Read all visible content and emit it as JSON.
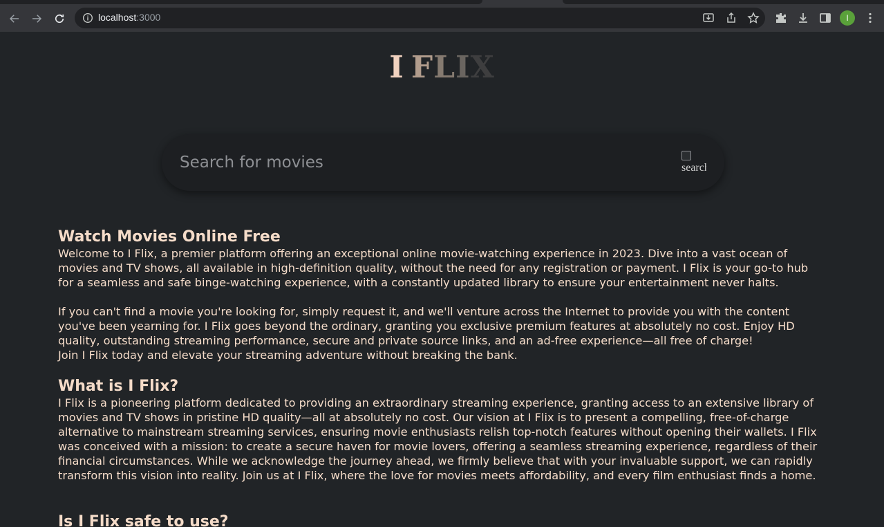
{
  "browser": {
    "url_host": "localhost",
    "url_port": ":3000",
    "profile_initial": "I"
  },
  "site": {
    "logo_letters": [
      "I",
      " ",
      "F",
      "L",
      "I",
      "X"
    ],
    "logo_colors": [
      "#f1d2bf",
      "#f1d2bf",
      "#b19c8c",
      "#857a70",
      "#6a6560",
      "#3e3e3f"
    ],
    "search_placeholder": "Search for movies",
    "search_icon_alt": "search"
  },
  "sections": [
    {
      "heading": "Watch Movies Online Free",
      "paragraphs": [
        "Welcome to I Flix, a premier platform offering an exceptional online movie-watching experience in 2023. Dive into a vast ocean of movies and TV shows, all available in high-definition quality, without the need for any registration or payment. I Flix is your go-to hub for a seamless and safe binge-watching experience, with a constantly updated library to ensure your entertainment never halts.",
        "If you can't find a movie you're looking for, simply request it, and we'll venture across the Internet to provide you with the content you've been yearning for. I Flix goes beyond the ordinary, granting you exclusive premium features at absolutely no cost. Enjoy HD quality, outstanding streaming performance, secure and private source links, and an ad-free experience—all free of charge!",
        "Join I Flix today and elevate your streaming adventure without breaking the bank."
      ]
    },
    {
      "heading": "What is I Flix?",
      "paragraphs": [
        "I Flix is a pioneering platform dedicated to providing an extraordinary streaming experience, granting access to an extensive library of movies and TV shows in pristine HD quality—all at absolutely no cost. Our vision at I Flix is to present a compelling, free-of-charge alternative to mainstream streaming services, ensuring movie enthusiasts relish top-notch features without opening their wallets. I Flix was conceived with a mission: to create a secure haven for movie lovers, offering a seamless streaming experience, regardless of their financial circumstances. While we acknowledge the journey ahead, we firmly believe that with your invaluable support, we can rapidly transform this vision into reality. Join us at I Flix, where the love for movies meets affordability, and every film enthusiast finds a home."
      ]
    },
    {
      "heading": "Is I Flix safe to use?"
    }
  ]
}
